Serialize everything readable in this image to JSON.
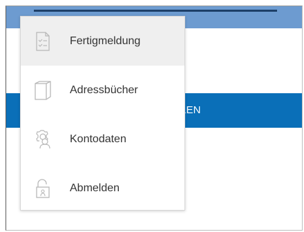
{
  "action_bar": {
    "label": "FÜLLEN"
  },
  "menu": {
    "items": [
      {
        "label": "Fertigmeldung",
        "icon": "checklist-icon",
        "active": true
      },
      {
        "label": "Adressbücher",
        "icon": "address-book-icon",
        "active": false
      },
      {
        "label": "Kontodaten",
        "icon": "account-settings-icon",
        "active": false
      },
      {
        "label": "Abmelden",
        "icon": "logout-lock-icon",
        "active": false
      }
    ]
  },
  "colors": {
    "header_blue": "#6d9bd0",
    "header_accent": "#1d3f68",
    "action_bar_blue": "#0a6fb8",
    "icon_gray": "#b8b8b8"
  }
}
